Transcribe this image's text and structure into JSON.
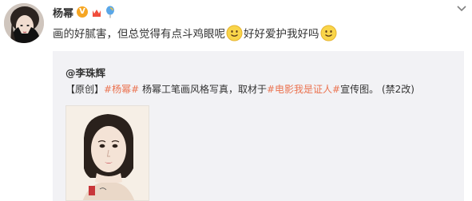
{
  "post": {
    "author": "杨幂",
    "text_1": "画的好腻害，但总觉得有点斗鸡眼呢",
    "text_2": "好好爱护我好吗",
    "badges": [
      "vip-badge",
      "crown-badge",
      "balloon-badge"
    ]
  },
  "repost": {
    "author": "@李珠辉",
    "bracket_open": "【",
    "original_tag": "原创",
    "bracket_close": "】",
    "hashtag_1": "#杨幂#",
    "text_a": " 杨幂工笔画风格写真，取材于",
    "hashtag_2": "#电影我是证人#",
    "text_b": "宣传图。",
    "edit_note": "(禁2改)"
  },
  "colors": {
    "text": "#333333",
    "hashtag": "#eb7350",
    "repost_bg": "#f2f2f5",
    "vip": "#f6a623"
  },
  "icons": {
    "menu": "chevron-down-icon",
    "emoji": "smiley-face-icon"
  }
}
